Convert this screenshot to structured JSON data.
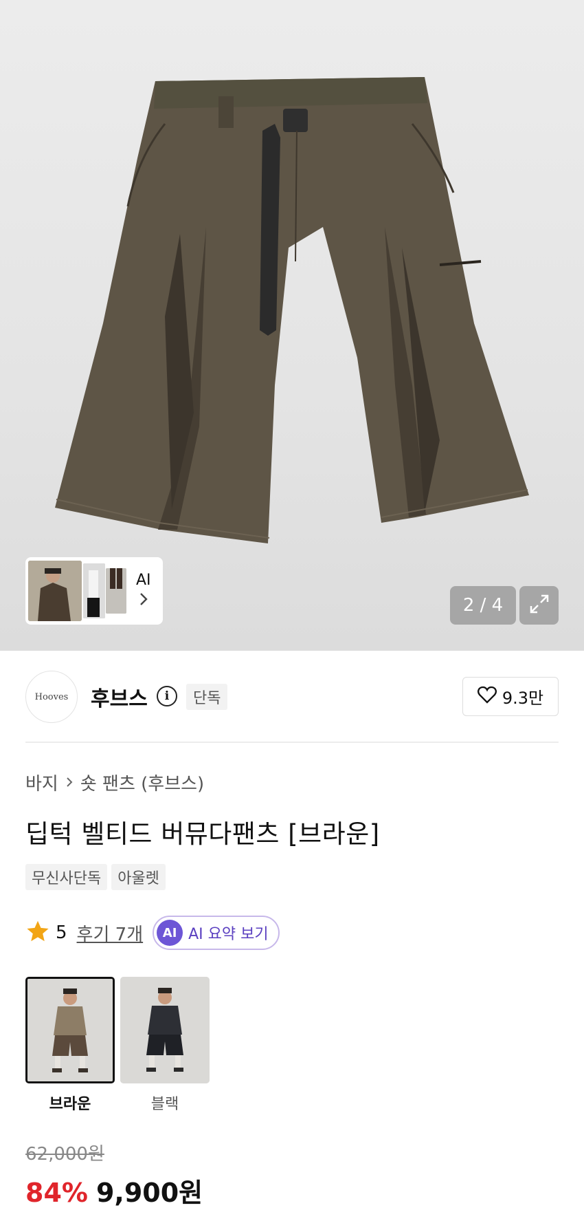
{
  "gallery": {
    "ai_label": "AI",
    "counter": "2 / 4"
  },
  "brand": {
    "logo_text": "Hooves",
    "name": "후브스",
    "badge": "단독",
    "likes": "9.3만"
  },
  "breadcrumb": {
    "category": "바지",
    "subcategory": "숏 팬츠 (후브스)"
  },
  "product": {
    "title": "딥턱 벨티드 버뮤다팬츠 [브라운]",
    "tags": [
      "무신사단독",
      "아울렛"
    ]
  },
  "rating": {
    "score": "5",
    "reviews": "후기 7개",
    "ai_badge": "AI",
    "ai_summary_label": "AI 요약 보기"
  },
  "options": [
    {
      "label": "브라운",
      "selected": true,
      "shirt_color": "#8d7d66",
      "shorts_color": "#5b4a3c"
    },
    {
      "label": "블랙",
      "selected": false,
      "shirt_color": "#2d2f35",
      "shorts_color": "#1f2126"
    }
  ],
  "price": {
    "original": "62,000원",
    "discount": "84%",
    "sale": "9,900원"
  },
  "colors": {
    "discount_red": "#e0252b",
    "ai_purple": "#6d56d6",
    "star_orange": "#f2a516",
    "shorts_brown": "#5e5546"
  },
  "icons": {
    "expand": "expand-icon",
    "heart": "heart-icon",
    "info": "info-icon",
    "star": "star-icon",
    "chevron": "chevron-right-icon"
  }
}
